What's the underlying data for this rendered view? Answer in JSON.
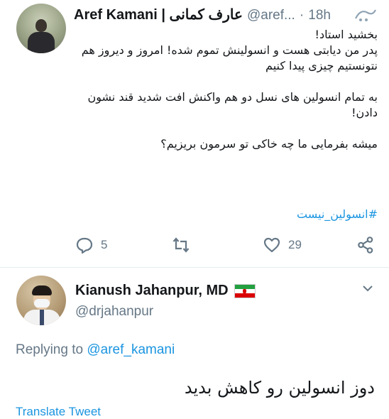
{
  "tweet": {
    "author_name": "Aref Kamani | عارف کمانی",
    "author_handle": "@aref...",
    "separator": "·",
    "time": "18h",
    "body_lines": [
      "بخشید استاد!",
      "پدر من دیابتی هست و انسولینش تموم شده! امروز و دیروز هم نتونستیم چیزی پیدا کنیم",
      "به تمام انسولین های نسل دو هم واکنش افت شدید قند نشون دادن!",
      "میشه بفرمایی ما چه خاکی تو سرمون بریزیم؟"
    ],
    "hashtag": "#انسولین_نیست",
    "reply_count": "5",
    "like_count": "29",
    "icons": [
      "reply-icon",
      "retweet-icon",
      "like-icon",
      "share-icon"
    ]
  },
  "reply": {
    "author_name": "Kianush Jahanpur, MD",
    "author_handle": "@drjahanpur",
    "replying_prefix": "Replying to",
    "replying_mention": "@aref_kamani",
    "text": "دوز انسولین رو کاهش بدید",
    "translate_label": "Translate Tweet",
    "flag": "iran-flag-icon"
  },
  "colors": {
    "link": "#1b95e0",
    "muted": "#657786",
    "text": "#14171a"
  }
}
